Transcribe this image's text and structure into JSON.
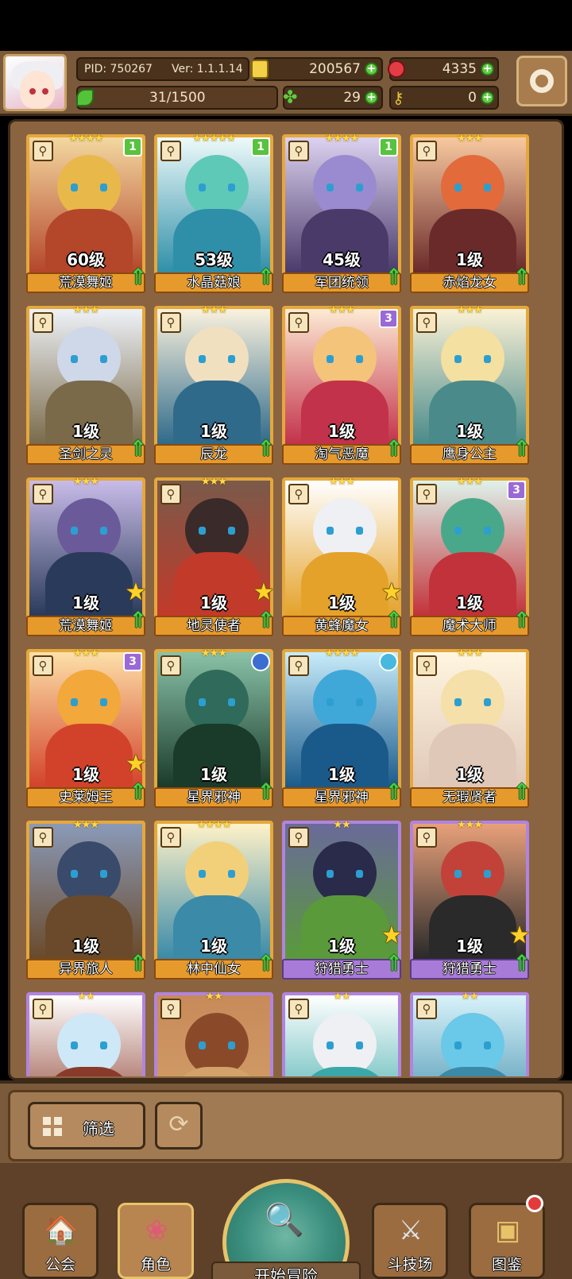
{
  "header": {
    "pid": "PID: 750267",
    "version": "Ver: 1.1.1.14",
    "gold": "200567",
    "gems": "4335",
    "exp": "31/1500",
    "clover": "29",
    "keys": "0"
  },
  "cards": [
    {
      "level": "60级",
      "name": "荒漠舞姬",
      "stars": "★★★★",
      "badge": "1",
      "badge_color": "#58c33e"
    },
    {
      "level": "53级",
      "name": "水晶菇娘",
      "stars": "★★★★★",
      "badge": "1",
      "badge_color": "#58c33e"
    },
    {
      "level": "45级",
      "name": "军团统领",
      "stars": "★★★★",
      "badge": "1",
      "badge_color": "#58c33e"
    },
    {
      "level": "1级",
      "name": "赤焰龙女",
      "stars": "★★★"
    },
    {
      "level": "1级",
      "name": "圣剑之灵",
      "stars": "★★★"
    },
    {
      "level": "1级",
      "name": "辰龙",
      "stars": "★★★"
    },
    {
      "level": "1级",
      "name": "淘气恶魔",
      "stars": "★★★",
      "badge": "3",
      "badge_color": "#9b69d6"
    },
    {
      "level": "1级",
      "name": "鹰身公主",
      "stars": "★★★"
    },
    {
      "level": "1级",
      "name": "荒漠舞姬",
      "stars": "★★★"
    },
    {
      "level": "1级",
      "name": "地灵使者",
      "stars": "★★★"
    },
    {
      "level": "1级",
      "name": "黄蜂魔女",
      "stars": "★★★"
    },
    {
      "level": "1级",
      "name": "魔术大师",
      "stars": "★★★",
      "badge": "3",
      "badge_color": "#9b69d6"
    },
    {
      "level": "1级",
      "name": "史莱姆王",
      "stars": "★★★",
      "badge": "3",
      "badge_color": "#9b69d6"
    },
    {
      "level": "1级",
      "name": "星界邪神",
      "stars": "★★★"
    },
    {
      "level": "1级",
      "name": "星界邪神",
      "stars": "★★★★"
    },
    {
      "level": "1级",
      "name": "无瑕贤者",
      "stars": "★★★"
    },
    {
      "level": "1级",
      "name": "异界旅人",
      "stars": "★★★"
    },
    {
      "level": "1级",
      "name": "林中仙女",
      "stars": "★★★★"
    },
    {
      "level": "1级",
      "name": "狩猎勇士",
      "stars": "★★"
    },
    {
      "level": "1级",
      "name": "狩猎勇士",
      "stars": "★★★"
    },
    {
      "level": "",
      "name": "",
      "stars": "★★"
    },
    {
      "level": "",
      "name": "",
      "stars": "★★"
    },
    {
      "level": "",
      "name": "",
      "stars": "★★"
    },
    {
      "level": "",
      "name": "",
      "stars": "★★"
    }
  ],
  "toolbar": {
    "filter_label": "筛选"
  },
  "nav": {
    "guild": "公会",
    "role": "角色",
    "start": "开始冒险",
    "arena": "斗技场",
    "codex": "图鉴"
  },
  "colors": {
    "accent": "#e5a83c",
    "panel": "#7a5a3a",
    "frame_purple": "#b184e0"
  }
}
